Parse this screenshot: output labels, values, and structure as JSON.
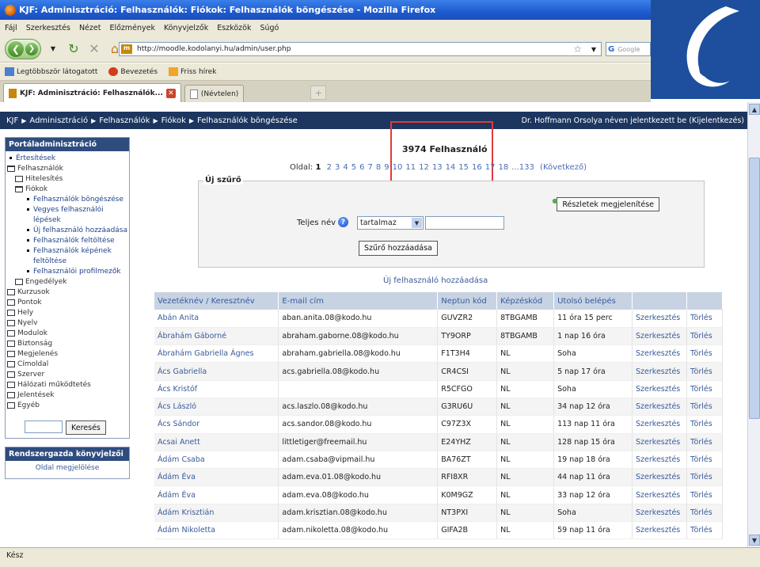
{
  "window": {
    "title": "KJF: Adminisztráció: Felhasználók: Fiókok: Felhasználók böngészése - Mozilla Firefox"
  },
  "menu": [
    "Fájl",
    "Szerkesztés",
    "Nézet",
    "Előzmények",
    "Könyvjelzők",
    "Eszközök",
    "Súgó"
  ],
  "url": "http://moodle.kodolanyi.hu/admin/user.php",
  "search_placeholder": "Google",
  "bookmarks": [
    {
      "label": "Legtöbbször látogatott",
      "color": "#4a7fd1"
    },
    {
      "label": "Bevezetés",
      "color": "#d23b1e"
    },
    {
      "label": "Friss hírek",
      "color": "#f0a52b"
    }
  ],
  "tabs": [
    {
      "label": "KJF: Adminisztráció: Felhasználók..."
    },
    {
      "label": "(Névtelen)"
    }
  ],
  "breadcrumb": [
    "KJF",
    "Adminisztráció",
    "Felhasználók",
    "Fiókok",
    "Felhasználók böngészése"
  ],
  "login_info": "Dr. Hoffmann Orsolya néven jelentkezett be (Kijelentkezés)",
  "sidebar": {
    "title": "Portáladminisztráció",
    "search_button": "Keresés",
    "bookmarks_title": "Rendszergazda könyvjelzői",
    "bookmarks_link": "Oldal megjelölése",
    "items": [
      {
        "label": "Értesítések",
        "type": "bullet",
        "level": 1
      },
      {
        "label": "Felhasználók",
        "type": "folder-open",
        "level": 1
      },
      {
        "label": "Hitelesítés",
        "type": "folder",
        "level": 2
      },
      {
        "label": "Fiókok",
        "type": "folder-open",
        "level": 2
      },
      {
        "label": "Felhasználók böngészése",
        "type": "bullet",
        "level": 3
      },
      {
        "label": "Vegyes felhasználói lépések",
        "type": "bullet",
        "level": 3
      },
      {
        "label": "Új felhasználó hozzáadása",
        "type": "bullet",
        "level": 3
      },
      {
        "label": "Felhasználók feltöltése",
        "type": "bullet",
        "level": 3
      },
      {
        "label": "Felhasználók képének feltöltése",
        "type": "bullet",
        "level": 3
      },
      {
        "label": "Felhasználói profilmezők",
        "type": "bullet",
        "level": 3
      },
      {
        "label": "Engedélyek",
        "type": "folder",
        "level": 2
      },
      {
        "label": "Kurzusok",
        "type": "folder",
        "level": 1
      },
      {
        "label": "Pontok",
        "type": "folder",
        "level": 1
      },
      {
        "label": "Hely",
        "type": "folder",
        "level": 1
      },
      {
        "label": "Nyelv",
        "type": "folder",
        "level": 1
      },
      {
        "label": "Modulok",
        "type": "folder",
        "level": 1
      },
      {
        "label": "Biztonság",
        "type": "folder",
        "level": 1
      },
      {
        "label": "Megjelenés",
        "type": "folder",
        "level": 1
      },
      {
        "label": "Címoldal",
        "type": "folder",
        "level": 1
      },
      {
        "label": "Szerver",
        "type": "folder",
        "level": 1
      },
      {
        "label": "Hálózati működtetés",
        "type": "folder",
        "level": 1
      },
      {
        "label": "Jelentések",
        "type": "folder",
        "level": 1
      },
      {
        "label": "Egyéb",
        "type": "folder",
        "level": 1
      }
    ]
  },
  "main": {
    "user_count": "3974 Felhasználó",
    "pager_label": "Oldal:",
    "current_page": "1",
    "pages": [
      "2",
      "3",
      "4",
      "5",
      "6",
      "7",
      "8",
      "9",
      "10",
      "11",
      "12",
      "13",
      "14",
      "15",
      "16",
      "17",
      "18",
      "...133"
    ],
    "next_label": "(Következő)",
    "filter": {
      "legend": "Új szűrő",
      "details_button": "Részletek megjelenítése",
      "field_label": "Teljes név",
      "operator": "tartalmaz",
      "add_button": "Szűrő hozzáadása"
    },
    "new_user_link": "Új felhasználó hozzáadása",
    "table": {
      "columns": [
        "Vezetéknév / Keresztnév",
        "E-mail cím",
        "Neptun kód",
        "Képzéskód",
        "Utolsó belépés",
        "",
        ""
      ],
      "header_name": {
        "last": "Vezetéknév",
        "sep": " / ",
        "first": "Keresztnév"
      },
      "edit_label": "Szerkesztés",
      "delete_label": "Törlés",
      "rows": [
        {
          "name": "Abán Anita",
          "email": "aban.anita.08@kodo.hu",
          "neptun": "GUVZR2",
          "code": "8TBGAMB",
          "last": "11 óra 15 perc"
        },
        {
          "name": "Ábrahám Gáborné",
          "email": "abraham.gaborne.08@kodo.hu",
          "neptun": "TY9ORP",
          "code": "8TBGAMB",
          "last": "1 nap 16 óra"
        },
        {
          "name": "Ábrahám Gabriella Ágnes",
          "email": "abraham.gabriella.08@kodo.hu",
          "neptun": "F1T3H4",
          "code": "NL",
          "last": "Soha"
        },
        {
          "name": "Ács Gabriella",
          "email": "acs.gabriella.08@kodo.hu",
          "neptun": "CR4CSI",
          "code": "NL",
          "last": "5 nap 17 óra"
        },
        {
          "name": "Ács Kristóf",
          "email": "",
          "neptun": "R5CFGO",
          "code": "NL",
          "last": "Soha"
        },
        {
          "name": "Ács László",
          "email": "acs.laszlo.08@kodo.hu",
          "neptun": "G3RU6U",
          "code": "NL",
          "last": "34 nap 12 óra"
        },
        {
          "name": "Ács Sándor",
          "email": "acs.sandor.08@kodo.hu",
          "neptun": "C97Z3X",
          "code": "NL",
          "last": "113 nap 11 óra"
        },
        {
          "name": "Acsai Anett",
          "email": "littletiger@freemail.hu",
          "neptun": "E24YHZ",
          "code": "NL",
          "last": "128 nap 15 óra"
        },
        {
          "name": "Ádám Csaba",
          "email": "adam.csaba@vipmail.hu",
          "neptun": "BA76ZT",
          "code": "NL",
          "last": "19 nap 18 óra"
        },
        {
          "name": "Ádám Éva",
          "email": "adam.eva.01.08@kodo.hu",
          "neptun": "RFI8XR",
          "code": "NL",
          "last": "44 nap 11 óra"
        },
        {
          "name": "Ádám Éva",
          "email": "adam.eva.08@kodo.hu",
          "neptun": "K0M9GZ",
          "code": "NL",
          "last": "33 nap 12 óra"
        },
        {
          "name": "Ádám Krisztián",
          "email": "adam.krisztian.08@kodo.hu",
          "neptun": "NT3PXI",
          "code": "NL",
          "last": "Soha"
        },
        {
          "name": "Ádám Nikoletta",
          "email": "adam.nikoletta.08@kodo.hu",
          "neptun": "GIFA2B",
          "code": "NL",
          "last": "59 nap 11 óra"
        }
      ]
    }
  },
  "status": "Kész",
  "colors": {
    "accent": "#1c3660",
    "link": "#3a5a99",
    "highlight": "#e03b3b"
  }
}
